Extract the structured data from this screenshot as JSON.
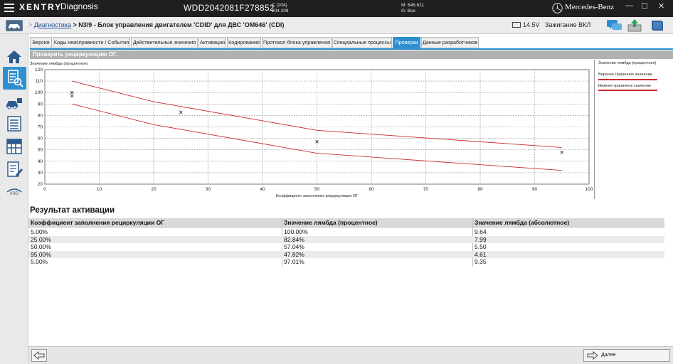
{
  "titlebar": {
    "brand": "XENTRY",
    "app_name": "Diagnosis",
    "vin": "WDD2042081F278852",
    "model_line1": "C (204)",
    "model_line2": "204.208",
    "m_line1": "M: 646.811",
    "m_line2": "G: Все",
    "maker": "Mercedes-Benz"
  },
  "breadcrumb": {
    "link": "Диагностика",
    "separator": ">",
    "current": "N3/9 - Блок управления двигателем 'CDID' для ДВС 'OM646' (CDI)"
  },
  "status": {
    "voltage": "14.5V",
    "ignition": "Зажигание ВКЛ"
  },
  "sidebar": {
    "xrd_label": "XRD"
  },
  "tabs": [
    {
      "label": "Версия"
    },
    {
      "label": "Коды неисправности / События"
    },
    {
      "label": "Действительные значения"
    },
    {
      "label": "Активации"
    },
    {
      "label": "Кодирования"
    },
    {
      "label": "Протокол блока управления"
    },
    {
      "label": "Специальные процессы"
    },
    {
      "label": "Проверки"
    },
    {
      "label": "Данные разработчиков"
    }
  ],
  "section_title": "Проверить рециркуляцию ОГ.",
  "legend": {
    "items": [
      "Значение лямбда (процентное)",
      "Верхнее граничное значение",
      "Нижнее граничное значение"
    ],
    "colors": {
      "limit": "#cc2b2b",
      "points": "#333333"
    }
  },
  "chart_data": {
    "type": "scatter",
    "title": "",
    "xlabel": "Коэффициент заполнения рециркуляции ОГ",
    "ylabel": "Значение лямбда (процентное)",
    "xlim": [
      0,
      100
    ],
    "ylim": [
      20,
      120
    ],
    "x_ticks": [
      0,
      10,
      20,
      30,
      40,
      50,
      60,
      70,
      80,
      90,
      100
    ],
    "y_ticks": [
      20,
      30,
      40,
      50,
      60,
      70,
      80,
      90,
      100,
      110,
      120
    ],
    "grid": true,
    "series": [
      {
        "name": "Значение лямбда (процентное)",
        "kind": "points",
        "x": [
          5,
          25,
          50,
          95,
          5
        ],
        "y": [
          100.0,
          82.84,
          57.04,
          47.82,
          97.01
        ]
      },
      {
        "name": "Верхнее граничное значение",
        "kind": "line",
        "x": [
          5,
          20,
          50,
          95
        ],
        "y": [
          110,
          92,
          67,
          52
        ]
      },
      {
        "name": "Нижнее граничное значение",
        "kind": "line",
        "x": [
          5,
          20,
          50,
          95
        ],
        "y": [
          90,
          72,
          47,
          32
        ]
      }
    ]
  },
  "results": {
    "title": "Результат активации",
    "headers": [
      "Коэффициент заполнения рециркуляции ОГ",
      "Значение лямбда (процентное)",
      "Значение лямбда (абсолютное)"
    ],
    "rows": [
      [
        "5.00%",
        "100.00%",
        "9.64"
      ],
      [
        "25.00%",
        "82.84%",
        "7.99"
      ],
      [
        "50.00%",
        "57.04%",
        "5.50"
      ],
      [
        "95.00%",
        "47.82%",
        "4.61"
      ],
      [
        "5.00%",
        "97.01%",
        "9.35"
      ]
    ]
  },
  "footer": {
    "next_label": "Далее"
  }
}
